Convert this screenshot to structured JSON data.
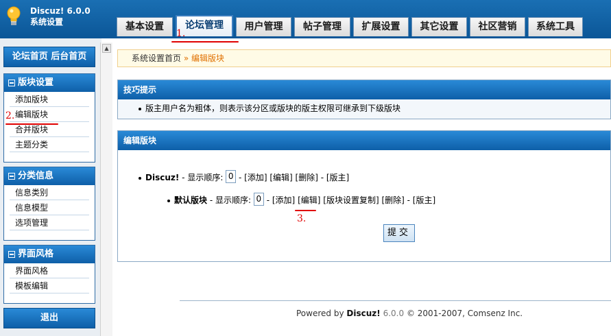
{
  "header": {
    "app_name": "Discuz! 6.0.0",
    "subtitle": "系统设置"
  },
  "tabs": [
    {
      "label": "基本设置"
    },
    {
      "label": "论坛管理"
    },
    {
      "label": "用户管理"
    },
    {
      "label": "帖子管理"
    },
    {
      "label": "扩展设置"
    },
    {
      "label": "其它设置"
    },
    {
      "label": "社区营销"
    },
    {
      "label": "系统工具"
    }
  ],
  "active_tab": "论坛管理",
  "annotations": [
    "1.",
    "2.",
    "3."
  ],
  "sidebar": {
    "nav_label": "论坛首页  后台首页",
    "sections": [
      {
        "title": "版块设置",
        "items": [
          "添加版块",
          "编辑版块",
          "合并版块",
          "主题分类"
        ]
      },
      {
        "title": "分类信息",
        "items": [
          "信息类别",
          "信息模型",
          "选项管理"
        ]
      },
      {
        "title": "界面风格",
        "items": [
          "界面风格",
          "模板编辑"
        ]
      }
    ],
    "logout_label": "退出"
  },
  "breadcrumb": {
    "home": "系统设置首页",
    "separator": "»",
    "current": "编辑版块"
  },
  "tips_panel": {
    "title": "技巧提示",
    "text": "版主用户名为粗体，则表示该分区或版块的版主权限可继承到下级版块"
  },
  "edit_panel": {
    "title": "编辑版块",
    "category": {
      "name": "Discuz!",
      "order_label": "- 显示顺序:",
      "order_value": "0",
      "actions": "- [添加] [编辑] [删除] - [版主]"
    },
    "forum": {
      "name": "默认版块",
      "order_label": "- 显示顺序:",
      "order_value": "0",
      "dash": "-",
      "add": "[添加]",
      "edit": "[编辑]",
      "rest": "[版块设置复制] [删除] - [版主]"
    },
    "submit_label": "提交"
  },
  "footer": {
    "powered": "Powered by",
    "brand": "Discuz!",
    "version": "6.0.0",
    "copyright": "© 2001-2007, Comsenz Inc."
  },
  "colors": {
    "header_blue": "#0b5697",
    "annotation_red": "#e00000",
    "breadcrumb_accent": "#e07000"
  }
}
